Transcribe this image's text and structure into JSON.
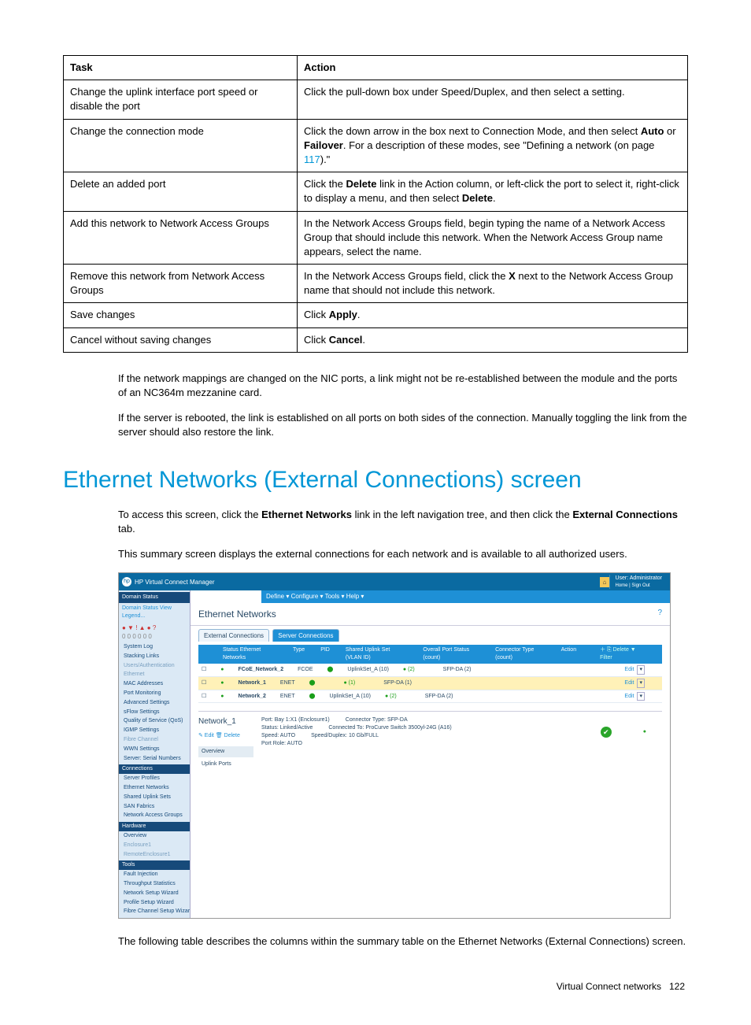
{
  "table": {
    "headers": [
      "Task",
      "Action"
    ],
    "rows": [
      {
        "task": "Change the uplink interface port speed or disable the port",
        "action": "Click the pull-down box under Speed/Duplex, and then select a setting."
      },
      {
        "task": "Change the connection mode",
        "action_pre": "Click the down arrow in the box next to Connection Mode, and then select ",
        "b1": "Auto",
        "mid": " or ",
        "b2": "Failover",
        "post1": ". For a description of these modes, see \"Defining a network (on page ",
        "link": "117",
        "post2": ").\""
      },
      {
        "task": "Delete an added port",
        "action_pre": "Click the ",
        "b1": "Delete",
        "mid": " link in the Action column, or left-click the port to select it, right-click to display a menu, and then select ",
        "b2": "Delete",
        "post": "."
      },
      {
        "task": "Add this network to Network Access Groups",
        "action": "In the Network Access Groups field, begin typing the name of a Network Access Group that should include this network. When the Network Access Group name appears, select the name."
      },
      {
        "task": "Remove this network from Network Access Groups",
        "action_pre": "In the Network Access Groups field, click the ",
        "b1": "X",
        "post": " next to the Network Access Group name that should not include this network."
      },
      {
        "task": "Save changes",
        "action_pre": "Click ",
        "b1": "Apply",
        "post": "."
      },
      {
        "task": "Cancel without saving changes",
        "action_pre": "Click ",
        "b1": "Cancel",
        "post": "."
      }
    ]
  },
  "paragraphs": {
    "p1": "If the network mappings are changed on the NIC ports, a link might not be re-established between the module and the ports of an NC364m mezzanine card.",
    "p2": "If the server is rebooted, the link is established on all ports on both sides of the connection. Manually toggling the link from the server should also restore the link.",
    "h1": "Ethernet Networks (External Connections) screen",
    "p3_pre": "To access this screen, click the ",
    "p3_b1": "Ethernet Networks",
    "p3_mid": " link in the left navigation tree, and then click the ",
    "p3_b2": "External Connections",
    "p3_post": " tab.",
    "p4": "This summary screen displays the external connections for each network and is available to all authorized users.",
    "p5": "The following table describes the columns within the summary table on the Ethernet Networks (External Connections) screen."
  },
  "screenshot": {
    "app_title": "HP Virtual Connect Manager",
    "user_label": "User: Administrator",
    "user_sub": "Home | Sign Out",
    "menu": "Define ▾   Configure ▾   Tools ▾   Help ▾",
    "domain_status": "Domain Status",
    "legend": "Domain Status   View Legend...",
    "icons_row1": "●  ▼  !  ▲  ●  ?",
    "icons_row2": "0   0   0   0   0   0",
    "nav": [
      {
        "t": "System Log",
        "c": "item"
      },
      {
        "t": "Stacking Links",
        "c": "item"
      },
      {
        "t": "Users/Authentication",
        "c": "item off"
      },
      {
        "t": "Ethernet",
        "c": "item off"
      },
      {
        "t": "MAC Addresses",
        "c": "item"
      },
      {
        "t": "Port Monitoring",
        "c": "item"
      },
      {
        "t": "Advanced Settings",
        "c": "item"
      },
      {
        "t": "sFlow Settings",
        "c": "item"
      },
      {
        "t": "Quality of Service (QoS)",
        "c": "item"
      },
      {
        "t": "IGMP Settings",
        "c": "item"
      },
      {
        "t": "Fibre Channel",
        "c": "item off"
      },
      {
        "t": "WWN Settings",
        "c": "item"
      },
      {
        "t": "Server: Serial Numbers",
        "c": "item"
      },
      {
        "t": "Connections",
        "c": "group"
      },
      {
        "t": "Server Profiles",
        "c": "item"
      },
      {
        "t": "Ethernet Networks",
        "c": "item"
      },
      {
        "t": "Shared Uplink Sets",
        "c": "item"
      },
      {
        "t": "SAN Fabrics",
        "c": "item"
      },
      {
        "t": "Network Access Groups",
        "c": "item"
      },
      {
        "t": "Hardware",
        "c": "group"
      },
      {
        "t": "Overview",
        "c": "item"
      },
      {
        "t": "Enclosure1",
        "c": "item off"
      },
      {
        "t": "RemoteEnclosure1",
        "c": "item off"
      },
      {
        "t": "Tools",
        "c": "group"
      },
      {
        "t": "Fault Injection",
        "c": "item"
      },
      {
        "t": "Throughput Statistics",
        "c": "item"
      },
      {
        "t": "Network Setup Wizard",
        "c": "item"
      },
      {
        "t": "Profile Setup Wizard",
        "c": "item"
      },
      {
        "t": "Fibre Channel Setup Wizard",
        "c": "item"
      }
    ],
    "main_title": "Ethernet Networks",
    "tab1": "External Connections",
    "tab2": "Server Connections",
    "tbl_headers": {
      "c0": "",
      "c1": "Status  Ethernet Networks",
      "c2": "Type",
      "c3": "PID",
      "c4": "Shared Uplink Set (VLAN ID)",
      "c5": "Overall Port Status (count)",
      "c6": "Connector Type (count)",
      "c7": "Action"
    },
    "tbl_tools": "＋  ⎘ Delete  ▼ Filter",
    "rows": [
      {
        "nm": "FCoE_Network_2",
        "type": "FCOE",
        "sus": "UplinkSet_A (10)",
        "ps": "(2)",
        "ct": "SFP-DA (2)",
        "ed": "Edit"
      },
      {
        "nm": "Network_1",
        "type": "ENET",
        "sus": "",
        "ps": "(1)",
        "ct": "SFP-DA (1)",
        "ed": "Edit"
      },
      {
        "nm": "Network_2",
        "type": "ENET",
        "sus": "UplinkSet_A (10)",
        "ps": "(2)",
        "ct": "SFP-DA (2)",
        "ed": "Edit"
      }
    ],
    "detail_title": "Network_1",
    "detail_edit": "✎ Edit   🗑 Delete",
    "detail_ov": "Overview",
    "detail_up": "Uplink Ports",
    "info": {
      "port": "Port: Bay 1:X1 (Enclosure1)",
      "ctype": "Connector Type: SFP-DA",
      "status": "Status: Linked/Active",
      "conn_to": "Connected To: ProCurve Switch 3500yl-24G (A16)",
      "speed": "Speed: AUTO",
      "sd": "Speed/Duplex: 10 Gb/FULL",
      "role": "Port Role: AUTO"
    }
  },
  "footer": {
    "left": "Virtual Connect networks",
    "page": "122"
  }
}
